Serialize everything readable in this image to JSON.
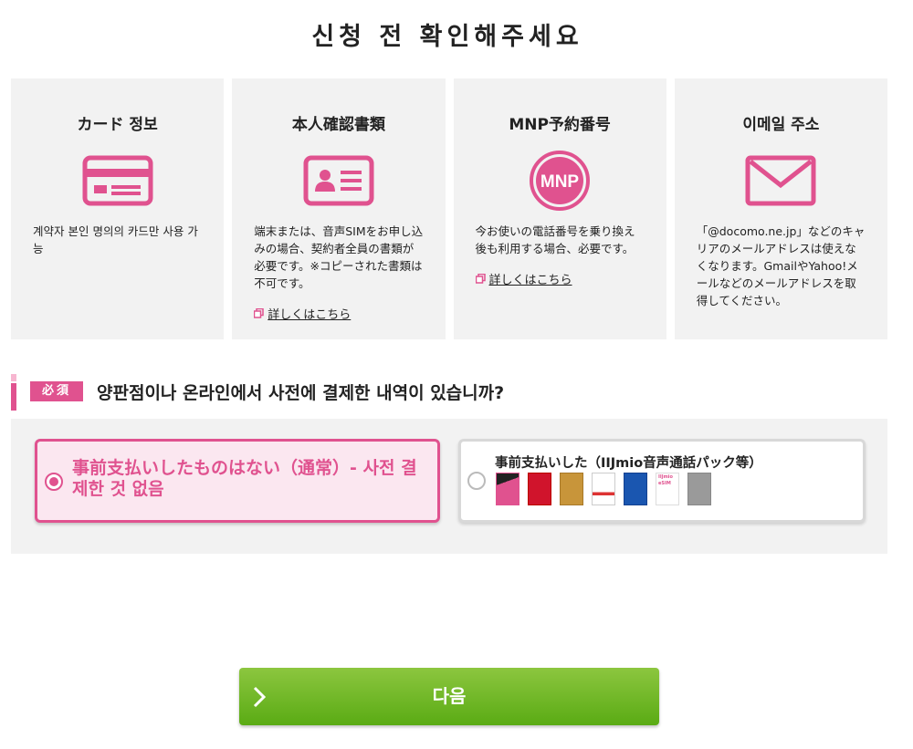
{
  "page": {
    "title": "신청 전 확인해주세요"
  },
  "cards": [
    {
      "title": "カード 정보",
      "icon": "credit-card-icon",
      "text": "계약자 본인 명의의 카드만 사용 가능"
    },
    {
      "title": "本人確認書類",
      "icon": "id-card-icon",
      "text": "端末または、音声SIMをお申し込みの場合、契約者全員の書類が必要です。※コピーされた書類は不可です。",
      "link": "詳しくはこちら"
    },
    {
      "title": "MNP予約番号",
      "icon": "mnp-badge-icon",
      "icon_text": "MNP",
      "text": "今お使いの電話番号を乗り換え後も利用する場合、必要です。",
      "link": "詳しくはこちら"
    },
    {
      "title": "이메일 주소",
      "icon": "envelope-icon",
      "text": "「@docomo.ne.jp」などのキャリアのメールアドレスは使えなくなります。GmailやYahoo!メールなどのメールアドレスを取得してください。"
    }
  ],
  "question": {
    "badge": "必須",
    "text": "양판점이나 온라인에서 사전에 결제한 내역이 있습니까?",
    "options": [
      {
        "label": "事前支払いしたものはない（通常）- 사전 결제한 것 없음",
        "selected": true
      },
      {
        "label": "事前支払いした（IIJmio音声通話パック等）",
        "selected": false,
        "pack_texts": [
          "IIJmio",
          "eSIM"
        ]
      }
    ]
  },
  "next_button": {
    "label": "다음"
  },
  "colors": {
    "accent": "#e0528f",
    "card_bg": "#f2f2f2",
    "button_top": "#8cc63f",
    "button_bottom": "#5aab14"
  }
}
